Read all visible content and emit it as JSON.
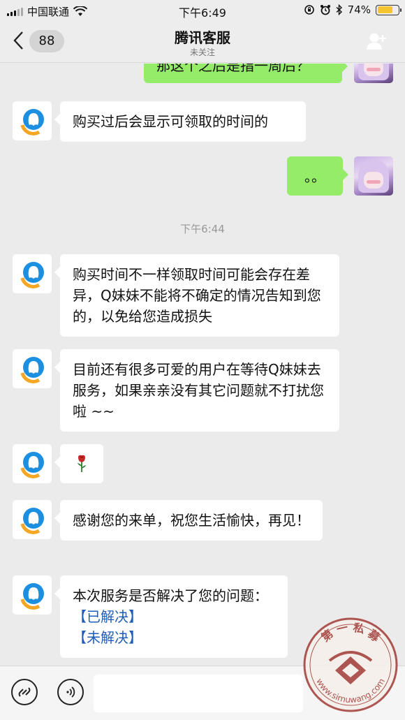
{
  "status_bar": {
    "carrier": "中国联通",
    "time": "下午6:49",
    "battery": "74%",
    "battery_level": 0.74
  },
  "nav": {
    "unread_count": "88",
    "title": "腾讯客服",
    "subtitle": "未关注"
  },
  "messages": {
    "m0": "那这个之后是指一周后？",
    "m1": "购买过后会显示可领取的时间的",
    "m2": "。。",
    "timestamp": "下午6:44",
    "m3": "购买时间不一样领取时间可能会存在差异，Q妹妹不能将不确定的情况告知到您的，以免给您造成损失",
    "m4": "目前还有很多可爱的用户在等待Q妹妹去服务，如果亲亲没有其它问题就不打扰您啦 ~~",
    "m5": "🌹",
    "m6": "感谢您的来单，祝您生活愉快，再见！",
    "m7_text": "本次服务是否解决了您的问题：",
    "m7_link1": "【已解决】",
    "m7_link2": "【未解决】"
  },
  "watermark": {
    "top_text": "第 一 私 募",
    "bottom_text": "www.simuwang.com"
  },
  "colors": {
    "out_bubble": "#95ec69",
    "link": "#1f5db8",
    "qq_blue": "#1d8fe0",
    "qq_orange": "#f5a623"
  }
}
